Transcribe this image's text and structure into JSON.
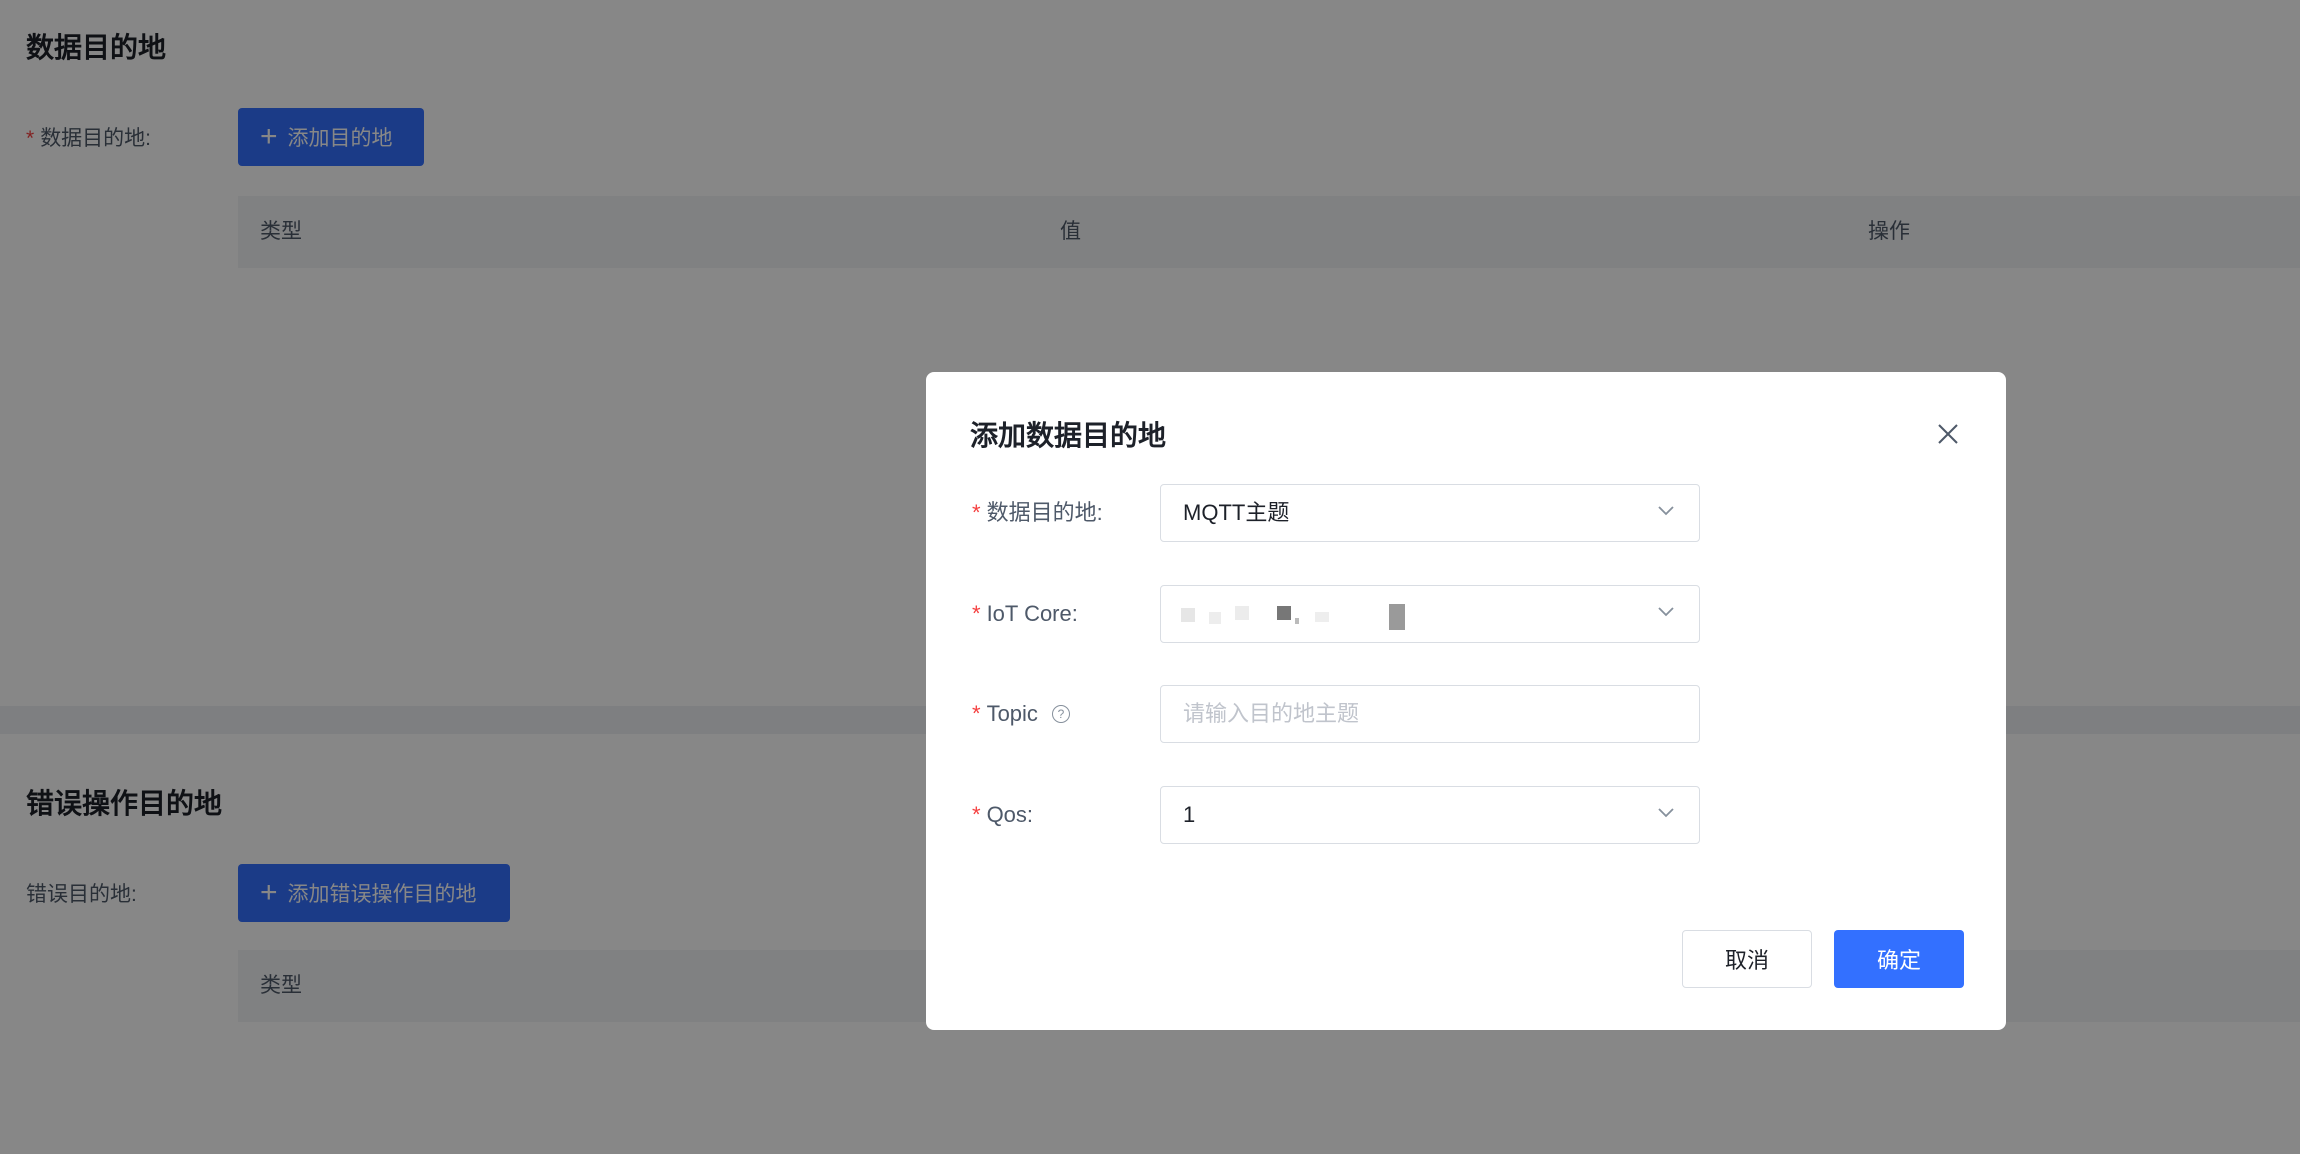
{
  "page": {
    "section1_title": "数据目的地",
    "section1_field_label": "数据目的地:",
    "add_destination_label": "添加目的地",
    "table1_headers": [
      "类型",
      "值",
      "操作"
    ],
    "section2_title": "错误操作目的地",
    "section2_field_label": "错误目的地:",
    "add_error_destination_label": "添加错误操作目的地",
    "table2_headers": [
      "类型"
    ]
  },
  "modal": {
    "title": "添加数据目的地",
    "fields": {
      "destination": {
        "label": "数据目的地:",
        "value": "MQTT主题"
      },
      "iot_core": {
        "label": "IoT Core:",
        "value": ""
      },
      "topic": {
        "label": "Topic",
        "placeholder": "请输入目的地主题"
      },
      "qos": {
        "label": "Qos:",
        "value": "1"
      }
    },
    "cancel_label": "取消",
    "ok_label": "确定"
  },
  "colors": {
    "primary": "#3370ff",
    "required": "#f53f3f",
    "overlay": "rgba(0,0,0,0.47)"
  },
  "icons": [
    "plus-icon",
    "close-icon",
    "chevron-down-icon",
    "question-circle-icon"
  ]
}
